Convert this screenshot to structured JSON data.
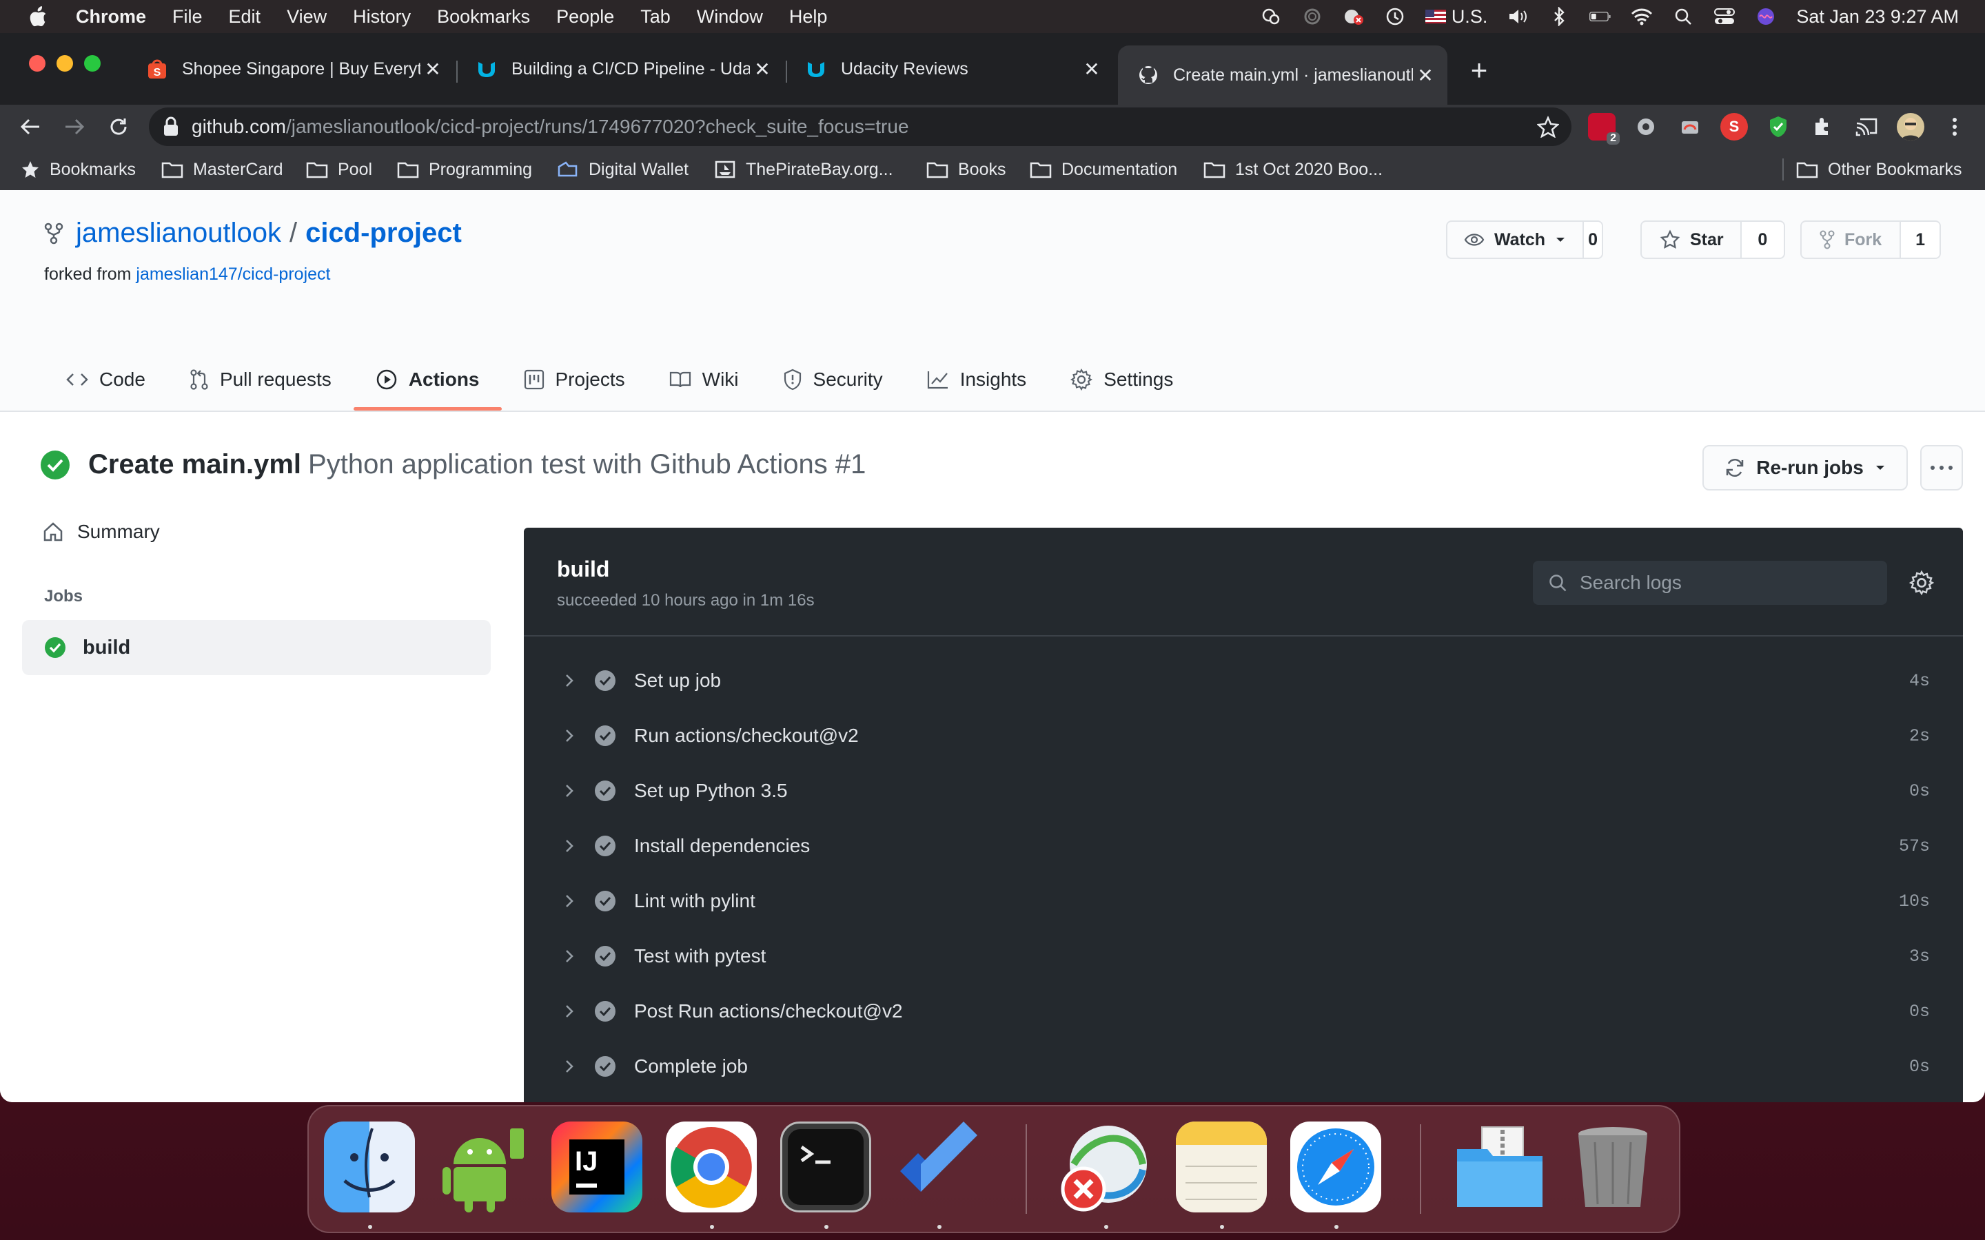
{
  "menubar": {
    "app": "Chrome",
    "menus": [
      "File",
      "Edit",
      "View",
      "History",
      "Bookmarks",
      "People",
      "Tab",
      "Window",
      "Help"
    ],
    "input_source": "U.S.",
    "datetime": "Sat Jan 23  9:27 AM"
  },
  "tabs": [
    {
      "title": "Shopee Singapore | Buy Everyt",
      "icon": "shopee-icon"
    },
    {
      "title": "Building a CI/CD Pipeline - Uda",
      "icon": "udacity-icon"
    },
    {
      "title": "Udacity Reviews",
      "icon": "udacity-icon"
    },
    {
      "title": "Create main.yml · jameslianoutl",
      "icon": "github-icon",
      "active": true
    }
  ],
  "omnibox": {
    "host": "github.com",
    "path": "/jameslianoutlook/cicd-project/runs/1749677020?check_suite_focus=true"
  },
  "extensions": {
    "badge_count": "2"
  },
  "bookmarks": {
    "label": "Bookmarks",
    "items": [
      "MasterCard",
      "Pool",
      "Programming",
      "Digital Wallet",
      "ThePirateBay.org...",
      "Books",
      "Documentation",
      "1st Oct 2020 Boo..."
    ],
    "other": "Other Bookmarks"
  },
  "repo": {
    "owner": "jameslianoutlook",
    "separator": "/",
    "name": "cicd-project",
    "forked_prefix": "forked from",
    "forked_from": "jameslian147/cicd-project",
    "watch_label": "Watch",
    "watch_count": "0",
    "star_label": "Star",
    "star_count": "0",
    "fork_label": "Fork",
    "fork_count": "1"
  },
  "nav": {
    "code": "Code",
    "pulls": "Pull requests",
    "actions": "Actions",
    "projects": "Projects",
    "wiki": "Wiki",
    "security": "Security",
    "insights": "Insights",
    "settings": "Settings"
  },
  "run": {
    "commit": "Create main.yml",
    "workflow": "Python application test with Github Actions #1",
    "rerun_label": "Re-run jobs"
  },
  "sidebar": {
    "summary": "Summary",
    "jobs_label": "Jobs",
    "job": "build"
  },
  "log": {
    "job_name": "build",
    "meta": "succeeded 10 hours ago in 1m 16s",
    "search_placeholder": "Search logs",
    "steps": [
      {
        "name": "Set up job",
        "duration": "4s"
      },
      {
        "name": "Run actions/checkout@v2",
        "duration": "2s"
      },
      {
        "name": "Set up Python 3.5",
        "duration": "0s"
      },
      {
        "name": "Install dependencies",
        "duration": "57s"
      },
      {
        "name": "Lint with pylint",
        "duration": "10s"
      },
      {
        "name": "Test with pytest",
        "duration": "3s"
      },
      {
        "name": "Post Run actions/checkout@v2",
        "duration": "0s"
      },
      {
        "name": "Complete job",
        "duration": "0s"
      }
    ]
  },
  "dock": {
    "apps": [
      "finder-icon",
      "android-studio-icon",
      "intellij-icon",
      "chrome-icon",
      "terminal-icon",
      "todo-icon",
      "network-app-icon",
      "notes-icon",
      "safari-icon",
      "downloads-folder-icon",
      "trash-icon"
    ]
  },
  "colors": {
    "success": "#28a745",
    "link": "#0366d6",
    "tab_underline": "#f9826c",
    "log_bg": "#24292e"
  }
}
